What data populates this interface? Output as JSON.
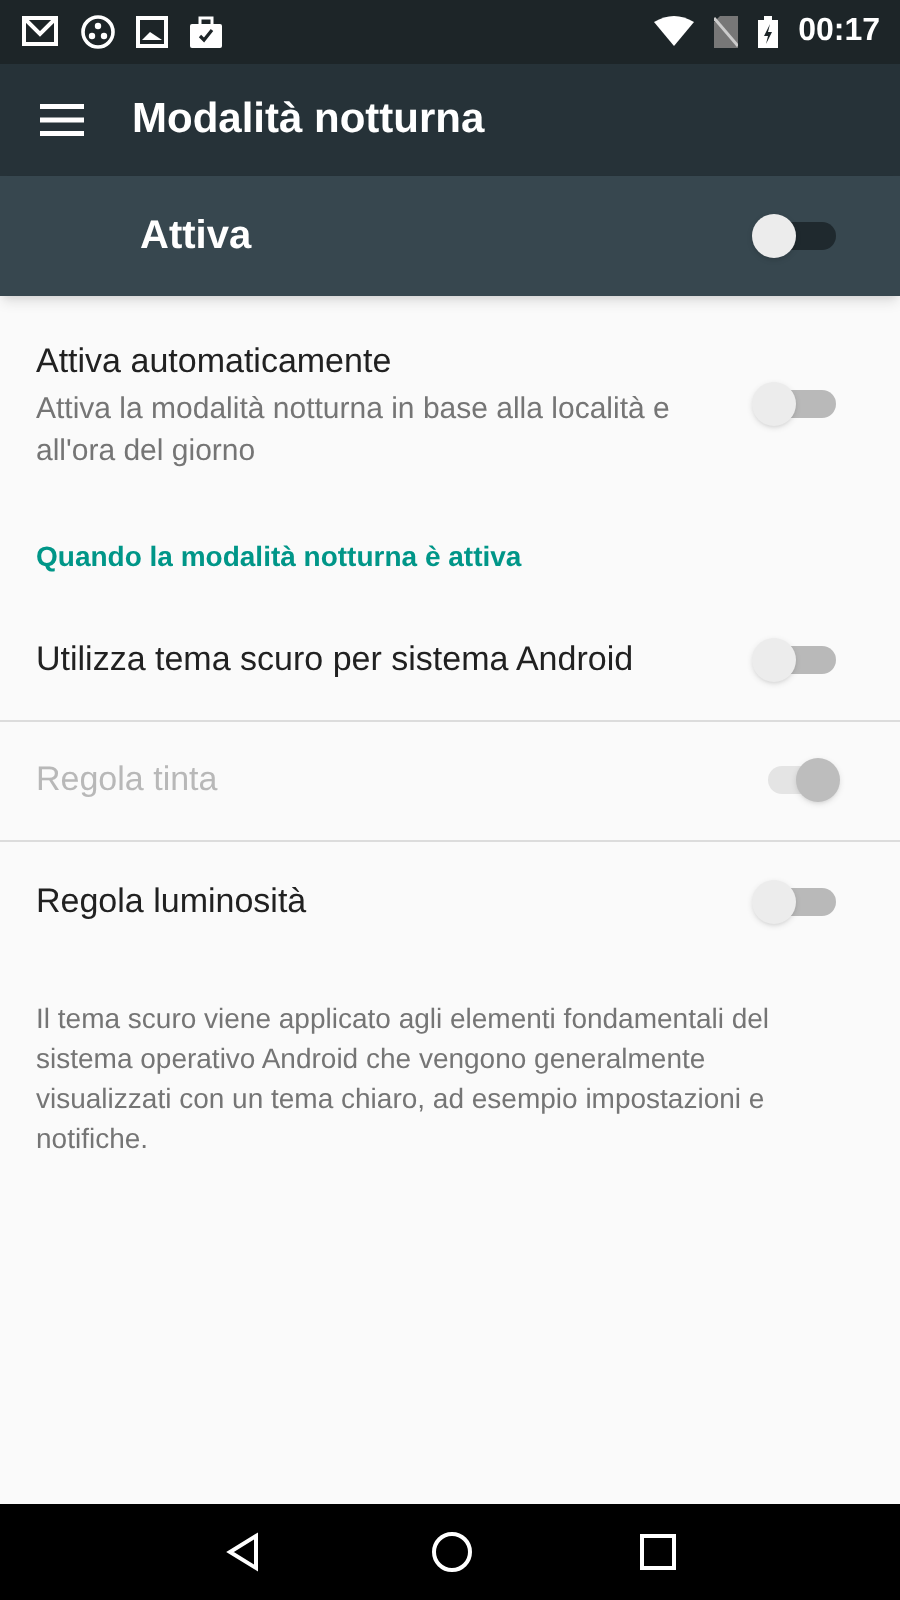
{
  "status_bar": {
    "time": "00:17"
  },
  "app_bar": {
    "title": "Modalità notturna"
  },
  "master_switch": {
    "label": "Attiva",
    "on": false
  },
  "settings": [
    {
      "kind": "switch",
      "title": "Attiva automaticamente",
      "summary": "Attiva la modalità notturna in base alla località e all'ora del giorno",
      "on": false,
      "disabled": false,
      "divider": false
    },
    {
      "kind": "header",
      "title": "Quando la modalità notturna è attiva"
    },
    {
      "kind": "switch",
      "title": "Utilizza tema scuro per sistema Android",
      "on": false,
      "disabled": false,
      "divider": true
    },
    {
      "kind": "switch",
      "title": "Regola tinta",
      "on": true,
      "disabled": true,
      "divider": true
    },
    {
      "kind": "switch",
      "title": "Regola luminosità",
      "on": false,
      "disabled": false,
      "divider": false
    },
    {
      "kind": "note",
      "title": "Il tema scuro viene applicato agli elementi fondamentali del sistema operativo Android che vengono generalmente visualizzati con un tema chiaro, ad esempio impostazioni e notifiche."
    }
  ]
}
